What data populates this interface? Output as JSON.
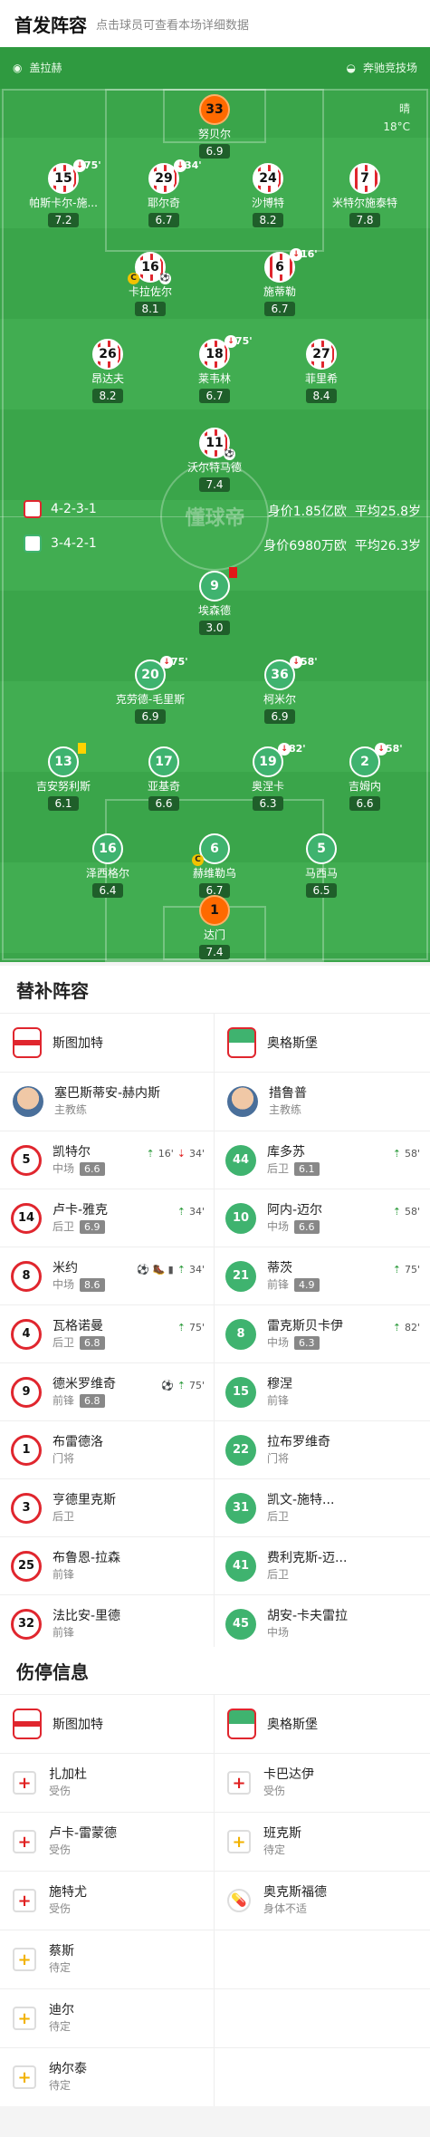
{
  "header": {
    "title": "首发阵容",
    "subtitle": "点击球员可查看本场详细数据"
  },
  "pitch": {
    "home_venue_label": "盖拉赫",
    "away_venue_label": "奔驰竞技场",
    "weather": "晴",
    "temperature": "18°C",
    "watermark": "懂球帝",
    "home": {
      "formation": "4-2-3-1",
      "value": "身价1.85亿欧",
      "age": "平均25.8岁"
    },
    "away": {
      "formation": "3-4-2-1",
      "value": "身价6980万欧",
      "age": "平均26.3岁"
    },
    "home_players": [
      {
        "no": "33",
        "name": "努贝尔",
        "rating": "6.9"
      },
      {
        "no": "15",
        "name": "帕斯卡尔-施...",
        "rating": "7.2",
        "sub": "75'"
      },
      {
        "no": "29",
        "name": "耶尔奇",
        "rating": "6.7",
        "sub": "34'"
      },
      {
        "no": "24",
        "name": "沙博特",
        "rating": "8.2"
      },
      {
        "no": "7",
        "name": "米特尔施泰特",
        "rating": "7.8"
      },
      {
        "no": "16",
        "name": "卡拉佐尔",
        "rating": "8.1"
      },
      {
        "no": "6",
        "name": "施蒂勒",
        "rating": "6.7",
        "sub": "16'"
      },
      {
        "no": "26",
        "name": "昂达夫",
        "rating": "8.2"
      },
      {
        "no": "18",
        "name": "莱韦林",
        "rating": "6.7",
        "sub": "75'"
      },
      {
        "no": "27",
        "name": "菲里希",
        "rating": "8.4"
      },
      {
        "no": "11",
        "name": "沃尔特马德",
        "rating": "7.4"
      }
    ],
    "away_players": [
      {
        "no": "9",
        "name": "埃森德",
        "rating": "3.0"
      },
      {
        "no": "20",
        "name": "克劳德-毛里斯",
        "rating": "6.9",
        "sub": "75'"
      },
      {
        "no": "36",
        "name": "柯米尔",
        "rating": "6.9",
        "sub": "58'"
      },
      {
        "no": "13",
        "name": "吉安努利斯",
        "rating": "6.1"
      },
      {
        "no": "17",
        "name": "亚基奇",
        "rating": "6.6"
      },
      {
        "no": "19",
        "name": "奥涅卡",
        "rating": "6.3",
        "sub": "82'"
      },
      {
        "no": "2",
        "name": "吉姆内",
        "rating": "6.6",
        "sub": "58'"
      },
      {
        "no": "16",
        "name": "泽西格尔",
        "rating": "6.4"
      },
      {
        "no": "6",
        "name": "赫维勒乌",
        "rating": "6.7"
      },
      {
        "no": "5",
        "name": "马西马",
        "rating": "6.5"
      },
      {
        "no": "1",
        "name": "达门",
        "rating": "7.4"
      }
    ]
  },
  "subs": {
    "title": "替补阵容",
    "home_team": "斯图加特",
    "away_team": "奥格斯堡",
    "home_coach": {
      "name": "塞巴斯蒂安-赫内斯",
      "role": "主教练"
    },
    "away_coach": {
      "name": "措鲁普",
      "role": "主教练"
    },
    "home": [
      {
        "no": "5",
        "name": "凯特尔",
        "pos": "中场",
        "rating": "6.6",
        "ev": "16'",
        "ev2": "34'"
      },
      {
        "no": "14",
        "name": "卢卡-雅克",
        "pos": "后卫",
        "rating": "6.9",
        "ev": "34'"
      },
      {
        "no": "8",
        "name": "米约",
        "pos": "中场",
        "rating": "8.6",
        "ev": "34'",
        "ev0": "⚽ 🥾 ▮"
      },
      {
        "no": "4",
        "name": "瓦格诺曼",
        "pos": "后卫",
        "rating": "6.8",
        "ev": "75'"
      },
      {
        "no": "9",
        "name": "德米罗维奇",
        "pos": "前锋",
        "rating": "6.8",
        "ev": "75'",
        "ev0": "⚽"
      },
      {
        "no": "1",
        "name": "布雷德洛",
        "pos": "门将"
      },
      {
        "no": "3",
        "name": "亨德里克斯",
        "pos": "后卫"
      },
      {
        "no": "25",
        "name": "布鲁恩-拉森",
        "pos": "前锋"
      },
      {
        "no": "32",
        "name": "法比安-里德",
        "pos": "前锋"
      }
    ],
    "away": [
      {
        "no": "44",
        "name": "库多苏",
        "pos": "后卫",
        "rating": "6.1",
        "ev": "58'"
      },
      {
        "no": "10",
        "name": "阿内-迈尔",
        "pos": "中场",
        "rating": "6.6",
        "ev": "58'"
      },
      {
        "no": "21",
        "name": "蒂茨",
        "pos": "前锋",
        "rating": "4.9",
        "ev": "75'"
      },
      {
        "no": "8",
        "name": "雷克斯贝卡伊",
        "pos": "中场",
        "rating": "6.3",
        "ev": "82'"
      },
      {
        "no": "15",
        "name": "穆涅",
        "pos": "前锋"
      },
      {
        "no": "22",
        "name": "拉布罗维奇",
        "pos": "门将"
      },
      {
        "no": "31",
        "name": "凯文-施特...",
        "pos": "后卫"
      },
      {
        "no": "41",
        "name": "费利克斯-迈...",
        "pos": "后卫"
      },
      {
        "no": "45",
        "name": "胡安-卡夫雷拉",
        "pos": "中场"
      }
    ]
  },
  "injuries": {
    "title": "伤停信息",
    "home_team": "斯图加特",
    "away_team": "奥格斯堡",
    "home": [
      {
        "name": "扎加杜",
        "status": "受伤",
        "icon": "+"
      },
      {
        "name": "卢卡-雷蒙德",
        "status": "受伤",
        "icon": "+"
      },
      {
        "name": "施特尤",
        "status": "受伤",
        "icon": "+"
      },
      {
        "name": "蔡斯",
        "status": "待定",
        "icon": "+"
      },
      {
        "name": "迪尔",
        "status": "待定",
        "icon": "+"
      },
      {
        "name": "纳尔泰",
        "status": "待定",
        "icon": "+"
      }
    ],
    "away": [
      {
        "name": "卡巴达伊",
        "status": "受伤",
        "icon": "+"
      },
      {
        "name": "班克斯",
        "status": "待定",
        "icon": "+"
      },
      {
        "name": "奥克斯福德",
        "status": "身体不适",
        "icon": "💊"
      }
    ]
  }
}
